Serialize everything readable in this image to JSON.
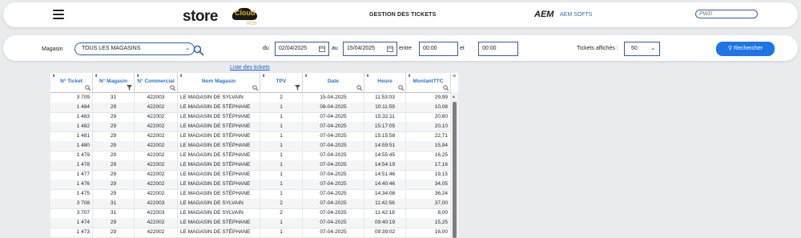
{
  "header": {
    "logo_word": "store",
    "logo_cloud": "Cloud",
    "logo_sub": "POS",
    "title": "GESTION DES TICKETS",
    "aem_logo": "AEM",
    "aem_text": "AEM SOFTS",
    "pwd_placeholder": "PWD"
  },
  "filters": {
    "magasin_label": "Magasin",
    "magasin_value": "TOUS LES MAGASINS",
    "du_label": "du",
    "date_from": "02/04/2025",
    "au_label": "au",
    "date_to": "15/04/2025",
    "entre_label": "entre",
    "time_from": "00:00",
    "et_label": "et",
    "time_to": "00:00",
    "tickets_label": "Tickets affichés :",
    "tickets_value": "50",
    "search_button": "Rechercher"
  },
  "list_link": "Liste des tickets",
  "table": {
    "columns": [
      "N° Ticket",
      "N° Magasin",
      "N° Commercial",
      "Nom Magasin",
      "TPV",
      "Date",
      "Heure",
      "MontantTTC"
    ],
    "rows": [
      [
        "3 709",
        "31",
        "422003",
        "LE MAGASIN DE SYLVAIN",
        "2",
        "15-04-2025",
        "11:53:03",
        "29,99"
      ],
      [
        "1 484",
        "29",
        "422002",
        "LE MAGASIN DE STÉPHANE",
        "1",
        "08-04-2025",
        "10:11:59",
        "10,08"
      ],
      [
        "1 483",
        "29",
        "422002",
        "LE MAGASIN DE STÉPHANE",
        "1",
        "07-04-2025",
        "15:32:11",
        "20,60"
      ],
      [
        "1 482",
        "29",
        "422002",
        "LE MAGASIN DE STÉPHANE",
        "1",
        "07-04-2025",
        "15:17:05",
        "20,10"
      ],
      [
        "1 481",
        "29",
        "422002",
        "LE MAGASIN DE STÉPHANE",
        "1",
        "07-04-2025",
        "15:15:58",
        "22,71"
      ],
      [
        "1 480",
        "29",
        "422002",
        "LE MAGASIN DE STÉPHANE",
        "1",
        "07-04-2025",
        "14:59:51",
        "15,94"
      ],
      [
        "1 479",
        "29",
        "422002",
        "LE MAGASIN DE STÉPHANE",
        "1",
        "07-04-2025",
        "14:55:45",
        "16,25"
      ],
      [
        "1 478",
        "29",
        "422002",
        "LE MAGASIN DE STÉPHANE",
        "1",
        "07-04-2025",
        "14:54:19",
        "17,16"
      ],
      [
        "1 477",
        "29",
        "422002",
        "LE MAGASIN DE STÉPHANE",
        "1",
        "07-04-2025",
        "14:51:46",
        "19,15"
      ],
      [
        "1 476",
        "29",
        "422002",
        "LE MAGASIN DE STÉPHANE",
        "1",
        "07-04-2025",
        "14:40:46",
        "34,05"
      ],
      [
        "1 475",
        "29",
        "422002",
        "LE MAGASIN DE STÉPHANE",
        "1",
        "07-04-2025",
        "14:34:08",
        "36,24"
      ],
      [
        "3 708",
        "31",
        "422003",
        "LE MAGASIN DE SYLVAIN",
        "2",
        "07-04-2025",
        "11:42:56",
        "37,00"
      ],
      [
        "3 707",
        "31",
        "422003",
        "LE MAGASIN DE SYLVAIN",
        "2",
        "07-04-2025",
        "11:42:18",
        "8,00"
      ],
      [
        "1 474",
        "29",
        "422002",
        "LE MAGASIN DE STÉPHANE",
        "1",
        "07-04-2025",
        "09:40:19",
        "15,25"
      ],
      [
        "1 473",
        "29",
        "422002",
        "LE MAGASIN DE STÉPHANE",
        "1",
        "07-04-2025",
        "09:39:02",
        "16,00"
      ]
    ]
  },
  "colors": {
    "accent": "#1f74e8",
    "border": "#2a5db0",
    "header_text": "#2475d8"
  },
  "icons": [
    "hamburger-icon",
    "search-icon",
    "calendar-icon",
    "chevron-down-icon",
    "filter-icon",
    "sort-icon",
    "column-menu-icon"
  ]
}
